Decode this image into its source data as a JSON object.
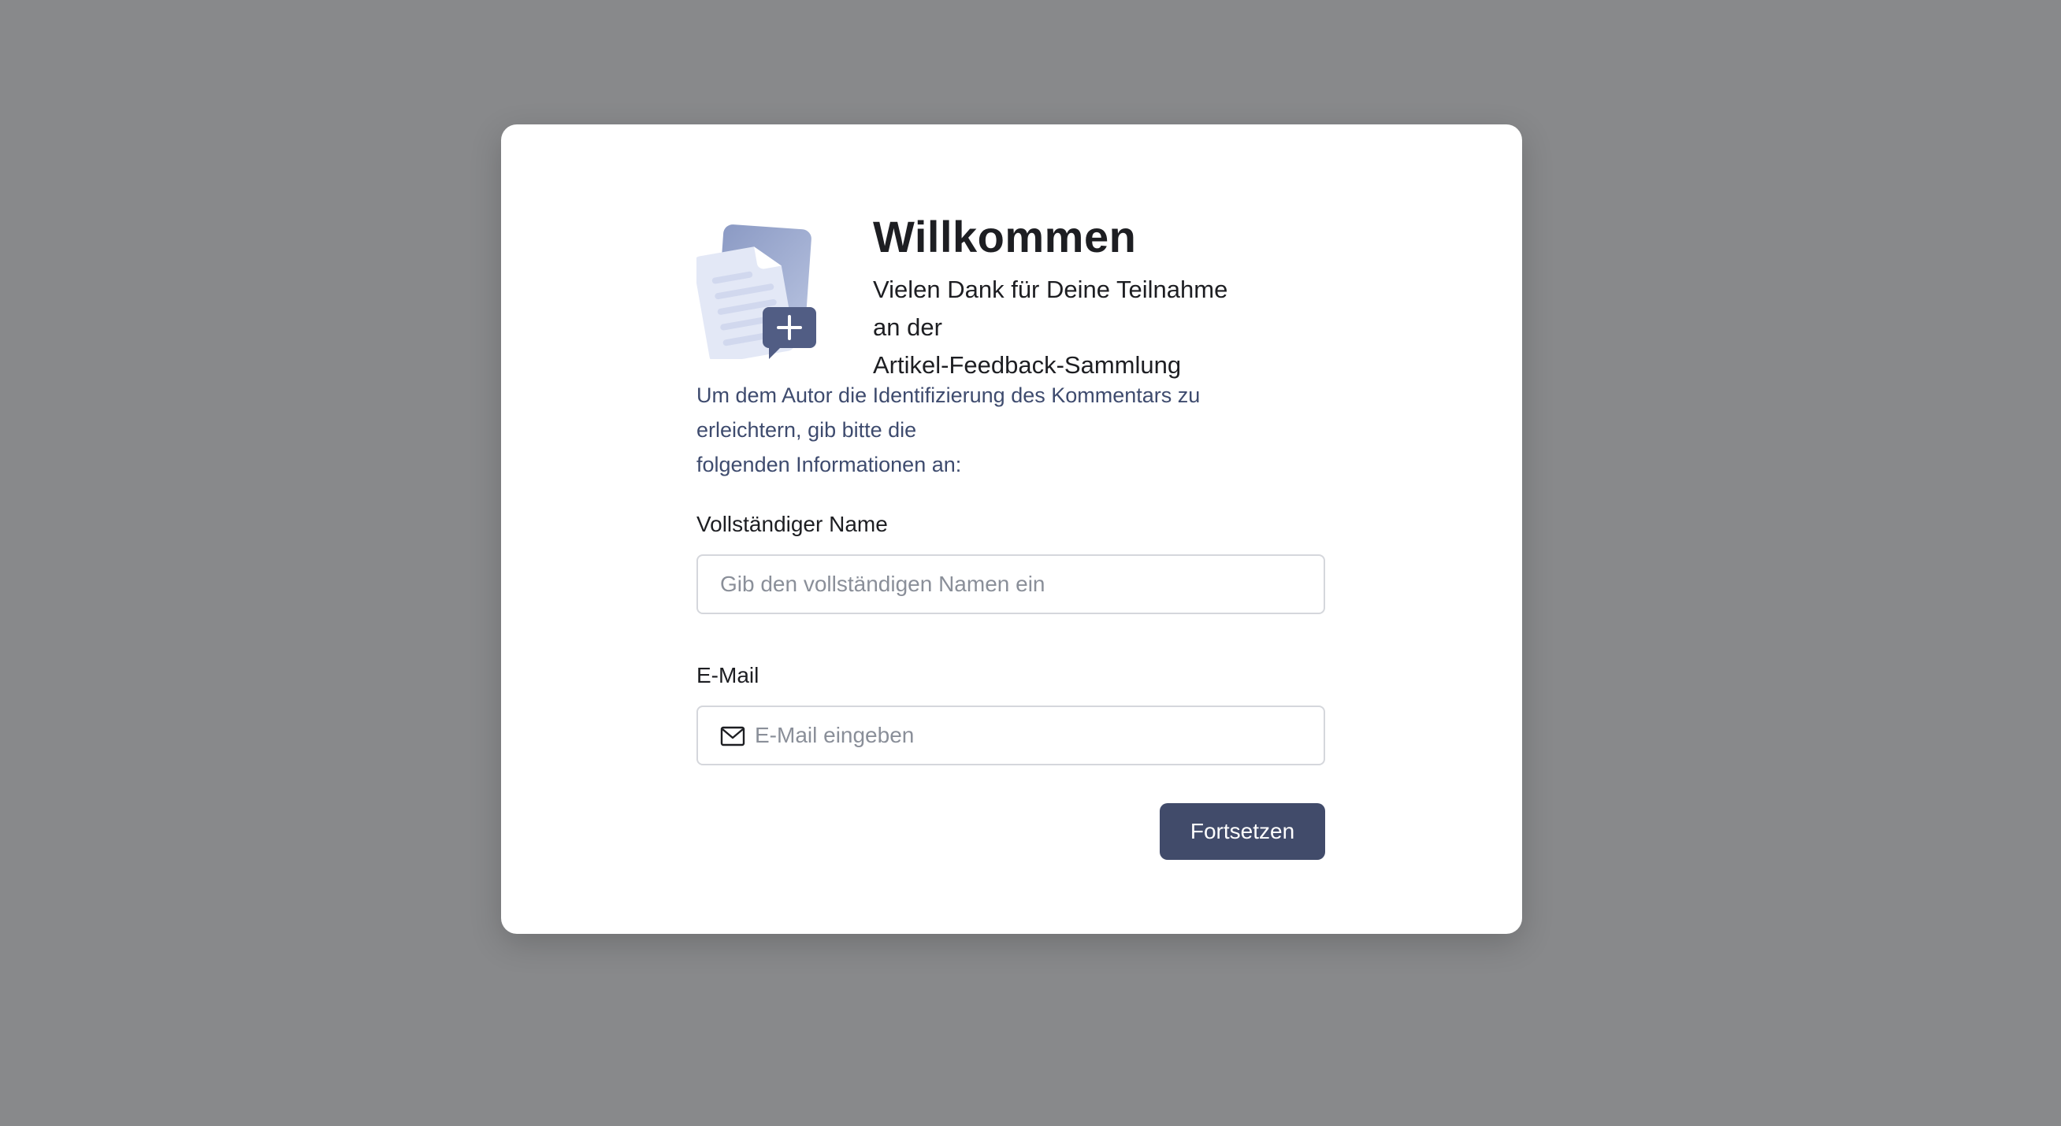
{
  "modal": {
    "title": "Willkommen",
    "subtitle_lines": [
      "Vielen Dank für Deine Teilnahme",
      "an der",
      "Artikel-Feedback-Sammlung"
    ],
    "intro_lines": [
      "Um dem Autor die Identifizierung des Kommentars zu",
      "erleichtern, gib bitte die",
      "folgenden Informationen an:"
    ],
    "illustration_icon": "document-comment-add-icon"
  },
  "form": {
    "name_label": "Vollständiger Name",
    "name_placeholder": "Gib den vollständigen Namen ein",
    "name_value": "",
    "email_label": "E-Mail",
    "email_placeholder": "E-Mail eingeben",
    "email_value": "",
    "email_icon": "mail-icon",
    "submit_label": "Fortsetzen"
  },
  "colors": {
    "backdrop": "#88898b",
    "card": "#ffffff",
    "title_text": "#1d1e22",
    "intro_text": "#3e4b6e",
    "button_bg": "#414b6a",
    "input_border": "#d5d7dc"
  }
}
